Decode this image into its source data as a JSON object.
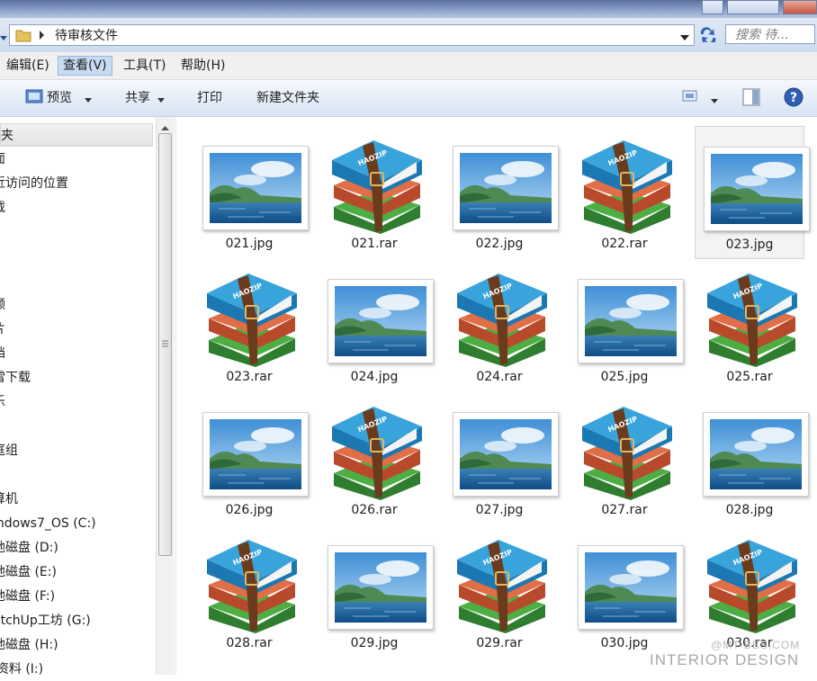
{
  "address": {
    "path": "待审核文件",
    "search_placeholder": "搜索 待..."
  },
  "menu": [
    "编辑(E)",
    "查看(V)",
    "工具(T)",
    "帮助(H)"
  ],
  "toolbar": {
    "preview": "预览",
    "share": "共享",
    "print": "打印",
    "new_folder": "新建文件夹"
  },
  "nav": {
    "items": [
      "夹",
      "面",
      "近访问的位置",
      "载",
      "频",
      "片",
      "档",
      "雷下载",
      "乐",
      "庭组",
      "算机",
      "indows7_OS (C:)",
      "地磁盘 (D:)",
      "地磁盘 (E:)",
      "地磁盘 (F:)",
      "etchUp工坊 (G:)",
      "地磁盘 (H:)",
      "l资料 (I:)"
    ]
  },
  "files": [
    {
      "name": "021.jpg",
      "type": "jpg"
    },
    {
      "name": "021.rar",
      "type": "rar"
    },
    {
      "name": "022.jpg",
      "type": "jpg"
    },
    {
      "name": "022.rar",
      "type": "rar"
    },
    {
      "name": "023.jpg",
      "type": "jpg"
    },
    {
      "name": "023.rar",
      "type": "rar"
    },
    {
      "name": "024.jpg",
      "type": "jpg"
    },
    {
      "name": "024.rar",
      "type": "rar"
    },
    {
      "name": "025.jpg",
      "type": "jpg"
    },
    {
      "name": "025.rar",
      "type": "rar"
    },
    {
      "name": "026.jpg",
      "type": "jpg"
    },
    {
      "name": "026.rar",
      "type": "rar"
    },
    {
      "name": "027.jpg",
      "type": "jpg"
    },
    {
      "name": "027.rar",
      "type": "rar"
    },
    {
      "name": "028.jpg",
      "type": "jpg"
    },
    {
      "name": "028.rar",
      "type": "rar"
    },
    {
      "name": "029.jpg",
      "type": "jpg"
    },
    {
      "name": "029.rar",
      "type": "rar"
    },
    {
      "name": "030.jpg",
      "type": "jpg"
    },
    {
      "name": "030.rar",
      "type": "rar"
    }
  ],
  "selected_file": "023.jpg",
  "rar_label": "HAOZIP",
  "watermark": {
    "line1": "@MT-BBS.COM",
    "line2": "INTERIOR DESIGN"
  }
}
